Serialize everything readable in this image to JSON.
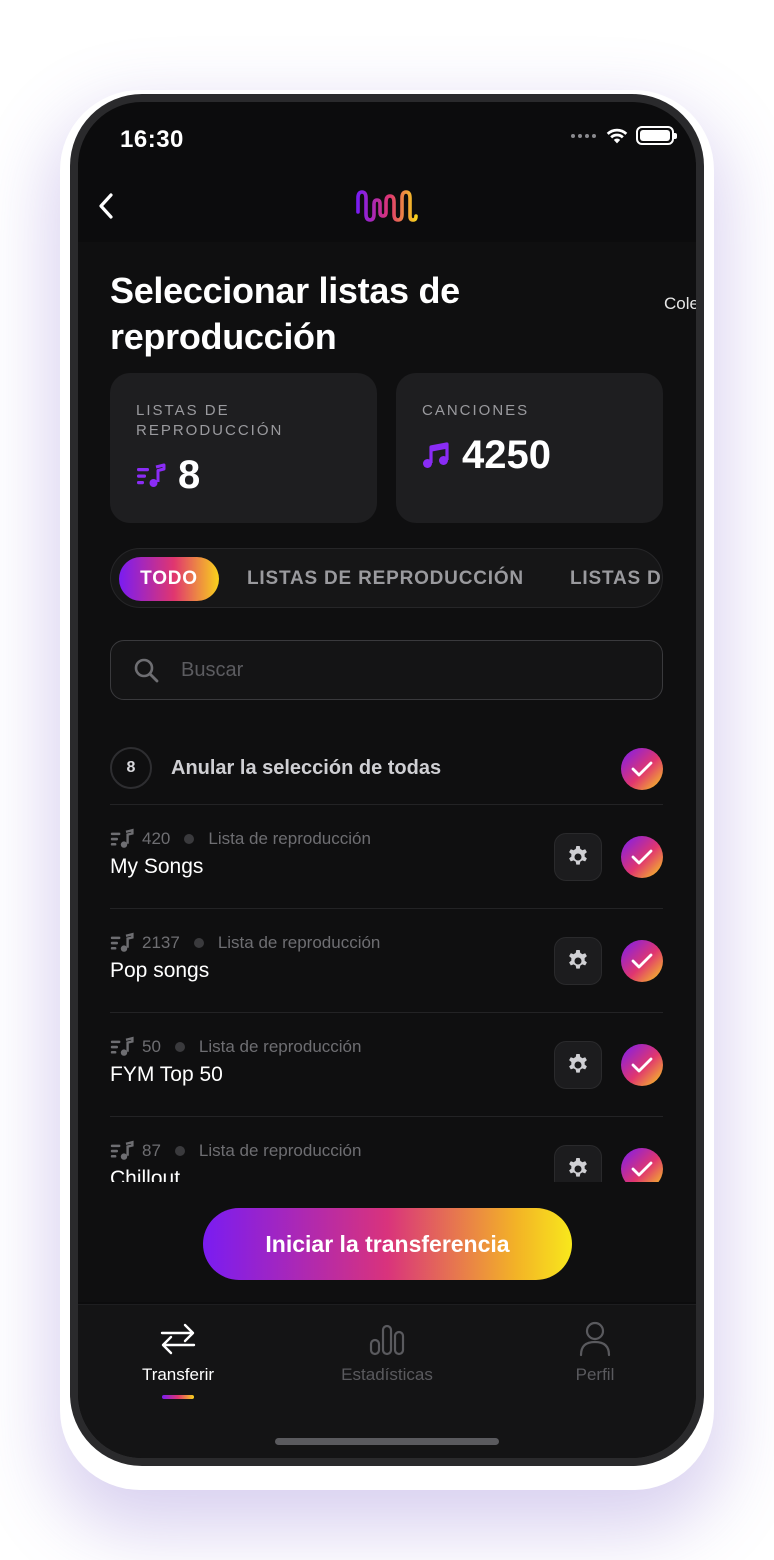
{
  "status_bar": {
    "time": "16:30"
  },
  "header": {
    "back_icon": "chevron-left-icon",
    "logo_icon": "soundwave-logo-icon"
  },
  "page": {
    "title": "Seleccionar listas de reproducción",
    "peek_label": "Cole"
  },
  "stats": {
    "playlists": {
      "label": "LISTAS DE REPRODUCCIÓN",
      "value": "8",
      "icon": "playlist-icon"
    },
    "songs": {
      "label": "CANCIONES",
      "value": "4250",
      "icon": "music-note-icon"
    }
  },
  "filter_tabs": [
    {
      "label": "TODO",
      "active": true
    },
    {
      "label": "LISTAS DE REPRODUCCIÓN",
      "active": false
    },
    {
      "label": "LISTAS DE",
      "active": false
    }
  ],
  "search": {
    "placeholder": "Buscar",
    "value": ""
  },
  "select_all": {
    "count": "8",
    "label": "Anular la selección de todas",
    "checked": true
  },
  "playlists": [
    {
      "count": "420",
      "type": "Lista de reproducción",
      "title": "My Songs",
      "checked": true
    },
    {
      "count": "2137",
      "type": "Lista de reproducción",
      "title": "Pop songs",
      "checked": true
    },
    {
      "count": "50",
      "type": "Lista de reproducción",
      "title": "FYM Top 50",
      "checked": true
    },
    {
      "count": "87",
      "type": "Lista de reproducción",
      "title": "Chillout",
      "checked": true
    }
  ],
  "cta": {
    "label": "Iniciar la transferencia"
  },
  "tab_bar": [
    {
      "label": "Transferir",
      "icon": "transfer-arrows-icon",
      "active": true
    },
    {
      "label": "Estadísticas",
      "icon": "bar-chart-icon",
      "active": false
    },
    {
      "label": "Perfil",
      "icon": "person-icon",
      "active": false
    }
  ],
  "colors": {
    "background": "#0f0f10",
    "card": "#1e1e20",
    "accent_purple": "#7a1cf2",
    "accent_pink": "#e0366f",
    "accent_yellow": "#f8d21c"
  }
}
